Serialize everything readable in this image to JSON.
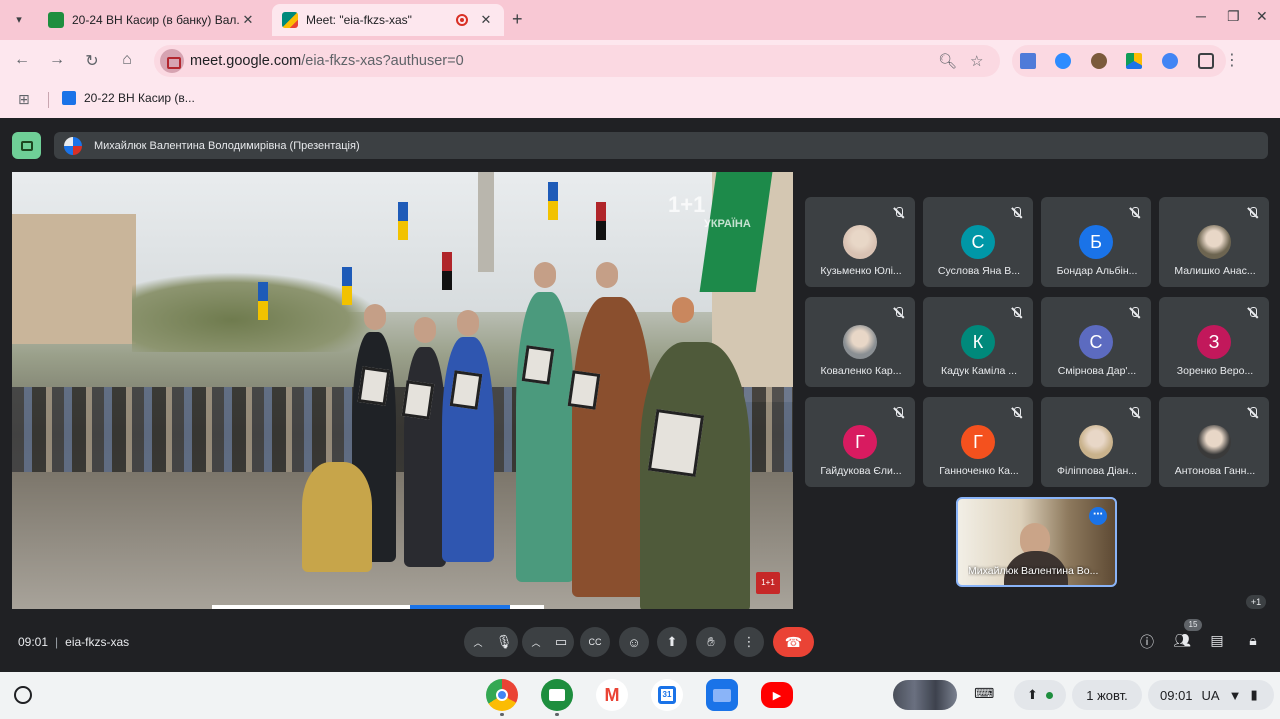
{
  "browser": {
    "tabs": [
      {
        "title": "20-24 ВН Касир (в банку) Вал...",
        "favicon_color": "#1e8e3e",
        "active": false
      },
      {
        "title": "Meet: \"eia-fkzs-xas\"",
        "favicon_color": "#00897b",
        "active": true,
        "recording": true
      }
    ],
    "new_tab_symbol": "+",
    "url_host": "meet.google.com",
    "url_path": "/eia-fkzs-xas?authuser=0",
    "bookmark": "20-22 ВН Касир (в..."
  },
  "meet": {
    "presenter_label": "Михайлюк Валентина Володимирівна (Презентація)",
    "video_logo": "1+1",
    "video_logo_sub": "УКРАЇНА",
    "video_badge": "1+1",
    "participants": [
      {
        "name": "Кузьменко Юлі...",
        "initial": "",
        "color": "#d9c2b3",
        "photo": true
      },
      {
        "name": "Суслова Яна В...",
        "initial": "С",
        "color": "#0097a7"
      },
      {
        "name": "Бондар Альбін...",
        "initial": "Б",
        "color": "#1a73e8"
      },
      {
        "name": "Малишко Анас...",
        "initial": "",
        "color": "#6d6551",
        "photo": true
      },
      {
        "name": "Коваленко Кар...",
        "initial": "",
        "color": "#8a8f93",
        "photo": true
      },
      {
        "name": "Кадук Каміла ...",
        "initial": "К",
        "color": "#00897b"
      },
      {
        "name": "Смірнова Дар'...",
        "initial": "С",
        "color": "#5c6bc0"
      },
      {
        "name": "Зоренко Веро...",
        "initial": "З",
        "color": "#c2185b"
      },
      {
        "name": "Гайдукова Єли...",
        "initial": "Г",
        "color": "#d81b60"
      },
      {
        "name": "Ганноченко Ка...",
        "initial": "Г",
        "color": "#f4511e"
      },
      {
        "name": "Філіппова Діан...",
        "initial": "",
        "color": "#c9b28c",
        "photo": true
      },
      {
        "name": "Антонова Ганн...",
        "initial": "",
        "color": "#3a3a3a",
        "photo": true
      }
    ],
    "self_name": "Михайлюк Валентина Во...",
    "more_participants": "+1",
    "time": "09:01",
    "meeting_code": "eia-fkzs-xas",
    "participant_count": "15"
  },
  "shelf": {
    "date": "1 жовт.",
    "clock": "09:01",
    "ime": "UA"
  }
}
